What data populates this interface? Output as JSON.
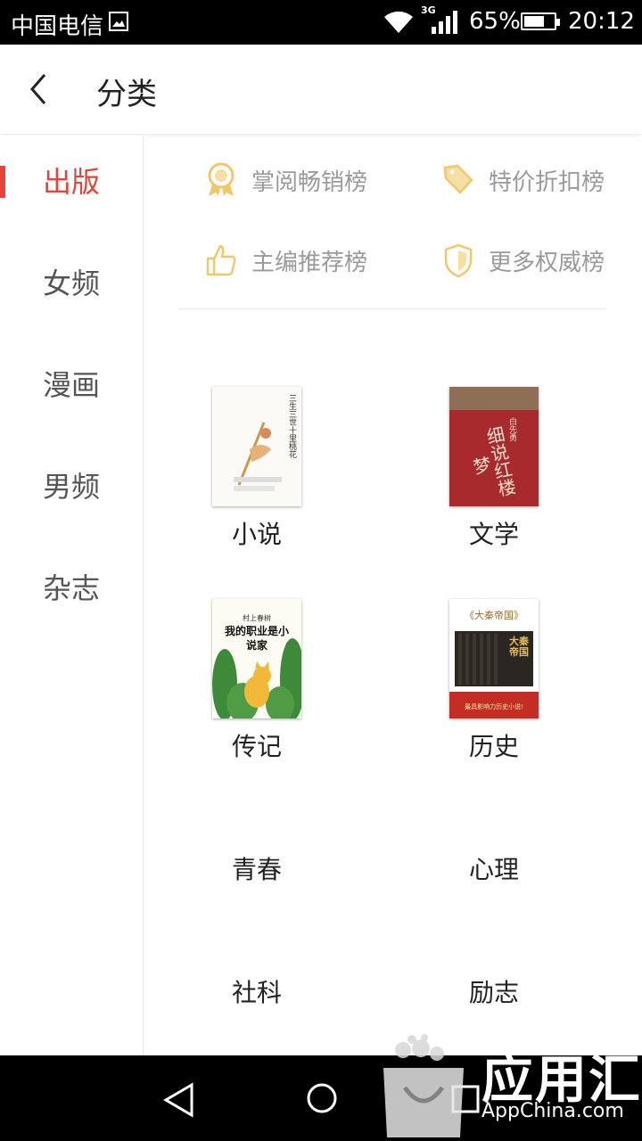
{
  "status_bar": {
    "carrier": "中国电信",
    "network": "3G",
    "battery": "65%",
    "time": "20:12"
  },
  "header": {
    "title": "分类"
  },
  "sidebar": {
    "items": [
      {
        "label": "出版",
        "active": true
      },
      {
        "label": "女频",
        "active": false
      },
      {
        "label": "漫画",
        "active": false
      },
      {
        "label": "男频",
        "active": false
      },
      {
        "label": "杂志",
        "active": false
      }
    ]
  },
  "rankings": [
    {
      "label": "掌阅畅销榜",
      "icon": "medal-icon"
    },
    {
      "label": "特价折扣榜",
      "icon": "price-tag-icon"
    },
    {
      "label": "主编推荐榜",
      "icon": "thumbs-up-icon"
    },
    {
      "label": "更多权威榜",
      "icon": "shield-icon"
    }
  ],
  "categories": [
    {
      "label": "小说",
      "cover_title": "三生三世十里桃花"
    },
    {
      "label": "文学",
      "cover_title": "细说红楼梦",
      "cover_author": "白先勇"
    },
    {
      "label": "传记",
      "cover_title": "我的职业是小说家",
      "cover_author": "村上春树"
    },
    {
      "label": "历史",
      "cover_title": "《大秦帝国》",
      "cover_tag": "最具影响力历史小说!",
      "cover_spine": "大秦帝国"
    },
    {
      "label": "青春"
    },
    {
      "label": "心理"
    },
    {
      "label": "社科"
    },
    {
      "label": "励志"
    }
  ],
  "watermark": {
    "text": "应用汇",
    "sub": "AppChina.com"
  },
  "colors": {
    "accent": "#e2463a",
    "ranking_icon": "#f0c86a",
    "ranking_text": "#9a9a9a"
  }
}
